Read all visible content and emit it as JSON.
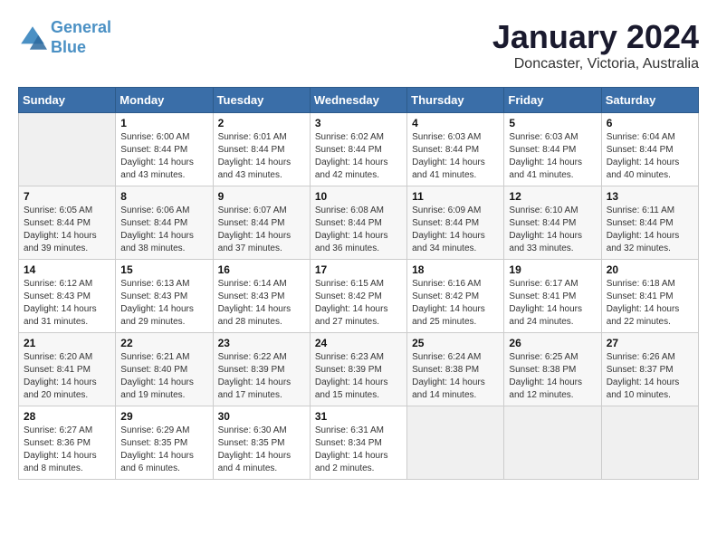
{
  "logo": {
    "line1": "General",
    "line2": "Blue"
  },
  "title": "January 2024",
  "subtitle": "Doncaster, Victoria, Australia",
  "days_header": [
    "Sunday",
    "Monday",
    "Tuesday",
    "Wednesday",
    "Thursday",
    "Friday",
    "Saturday"
  ],
  "weeks": [
    [
      {
        "num": "",
        "info": ""
      },
      {
        "num": "1",
        "info": "Sunrise: 6:00 AM\nSunset: 8:44 PM\nDaylight: 14 hours\nand 43 minutes."
      },
      {
        "num": "2",
        "info": "Sunrise: 6:01 AM\nSunset: 8:44 PM\nDaylight: 14 hours\nand 43 minutes."
      },
      {
        "num": "3",
        "info": "Sunrise: 6:02 AM\nSunset: 8:44 PM\nDaylight: 14 hours\nand 42 minutes."
      },
      {
        "num": "4",
        "info": "Sunrise: 6:03 AM\nSunset: 8:44 PM\nDaylight: 14 hours\nand 41 minutes."
      },
      {
        "num": "5",
        "info": "Sunrise: 6:03 AM\nSunset: 8:44 PM\nDaylight: 14 hours\nand 41 minutes."
      },
      {
        "num": "6",
        "info": "Sunrise: 6:04 AM\nSunset: 8:44 PM\nDaylight: 14 hours\nand 40 minutes."
      }
    ],
    [
      {
        "num": "7",
        "info": "Sunrise: 6:05 AM\nSunset: 8:44 PM\nDaylight: 14 hours\nand 39 minutes."
      },
      {
        "num": "8",
        "info": "Sunrise: 6:06 AM\nSunset: 8:44 PM\nDaylight: 14 hours\nand 38 minutes."
      },
      {
        "num": "9",
        "info": "Sunrise: 6:07 AM\nSunset: 8:44 PM\nDaylight: 14 hours\nand 37 minutes."
      },
      {
        "num": "10",
        "info": "Sunrise: 6:08 AM\nSunset: 8:44 PM\nDaylight: 14 hours\nand 36 minutes."
      },
      {
        "num": "11",
        "info": "Sunrise: 6:09 AM\nSunset: 8:44 PM\nDaylight: 14 hours\nand 34 minutes."
      },
      {
        "num": "12",
        "info": "Sunrise: 6:10 AM\nSunset: 8:44 PM\nDaylight: 14 hours\nand 33 minutes."
      },
      {
        "num": "13",
        "info": "Sunrise: 6:11 AM\nSunset: 8:44 PM\nDaylight: 14 hours\nand 32 minutes."
      }
    ],
    [
      {
        "num": "14",
        "info": "Sunrise: 6:12 AM\nSunset: 8:43 PM\nDaylight: 14 hours\nand 31 minutes."
      },
      {
        "num": "15",
        "info": "Sunrise: 6:13 AM\nSunset: 8:43 PM\nDaylight: 14 hours\nand 29 minutes."
      },
      {
        "num": "16",
        "info": "Sunrise: 6:14 AM\nSunset: 8:43 PM\nDaylight: 14 hours\nand 28 minutes."
      },
      {
        "num": "17",
        "info": "Sunrise: 6:15 AM\nSunset: 8:42 PM\nDaylight: 14 hours\nand 27 minutes."
      },
      {
        "num": "18",
        "info": "Sunrise: 6:16 AM\nSunset: 8:42 PM\nDaylight: 14 hours\nand 25 minutes."
      },
      {
        "num": "19",
        "info": "Sunrise: 6:17 AM\nSunset: 8:41 PM\nDaylight: 14 hours\nand 24 minutes."
      },
      {
        "num": "20",
        "info": "Sunrise: 6:18 AM\nSunset: 8:41 PM\nDaylight: 14 hours\nand 22 minutes."
      }
    ],
    [
      {
        "num": "21",
        "info": "Sunrise: 6:20 AM\nSunset: 8:41 PM\nDaylight: 14 hours\nand 20 minutes."
      },
      {
        "num": "22",
        "info": "Sunrise: 6:21 AM\nSunset: 8:40 PM\nDaylight: 14 hours\nand 19 minutes."
      },
      {
        "num": "23",
        "info": "Sunrise: 6:22 AM\nSunset: 8:39 PM\nDaylight: 14 hours\nand 17 minutes."
      },
      {
        "num": "24",
        "info": "Sunrise: 6:23 AM\nSunset: 8:39 PM\nDaylight: 14 hours\nand 15 minutes."
      },
      {
        "num": "25",
        "info": "Sunrise: 6:24 AM\nSunset: 8:38 PM\nDaylight: 14 hours\nand 14 minutes."
      },
      {
        "num": "26",
        "info": "Sunrise: 6:25 AM\nSunset: 8:38 PM\nDaylight: 14 hours\nand 12 minutes."
      },
      {
        "num": "27",
        "info": "Sunrise: 6:26 AM\nSunset: 8:37 PM\nDaylight: 14 hours\nand 10 minutes."
      }
    ],
    [
      {
        "num": "28",
        "info": "Sunrise: 6:27 AM\nSunset: 8:36 PM\nDaylight: 14 hours\nand 8 minutes."
      },
      {
        "num": "29",
        "info": "Sunrise: 6:29 AM\nSunset: 8:35 PM\nDaylight: 14 hours\nand 6 minutes."
      },
      {
        "num": "30",
        "info": "Sunrise: 6:30 AM\nSunset: 8:35 PM\nDaylight: 14 hours\nand 4 minutes."
      },
      {
        "num": "31",
        "info": "Sunrise: 6:31 AM\nSunset: 8:34 PM\nDaylight: 14 hours\nand 2 minutes."
      },
      {
        "num": "",
        "info": ""
      },
      {
        "num": "",
        "info": ""
      },
      {
        "num": "",
        "info": ""
      }
    ]
  ]
}
